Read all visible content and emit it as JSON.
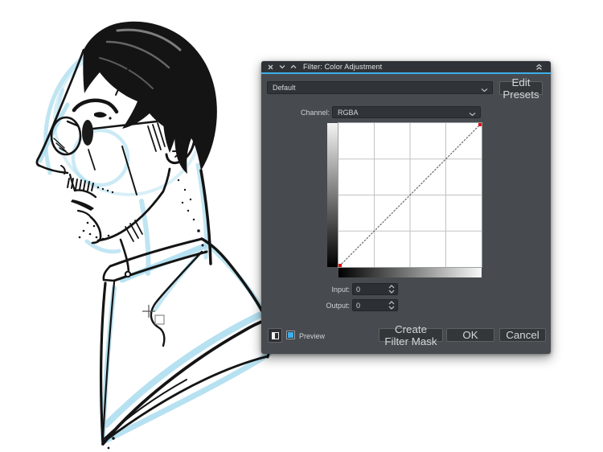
{
  "titlebar": {
    "title": "Filter: Color Adjustment",
    "icons": [
      "close-icon",
      "float-icon",
      "collapse-icon",
      "shade-icon"
    ]
  },
  "preset": {
    "selected": "Default",
    "edit_presets_label": "Edit Presets"
  },
  "channel": {
    "label": "Channel:",
    "selected": "RGBA"
  },
  "curve": {
    "grid_divisions": 4,
    "points": [
      [
        0,
        0
      ],
      [
        255,
        255
      ]
    ],
    "input_label": "Input:",
    "input_value": "0",
    "output_label": "Output:",
    "output_value": "0"
  },
  "footer": {
    "preview_label": "Preview",
    "create_filter_mask_label": "Create Filter Mask",
    "ok_label": "OK",
    "cancel_label": "Cancel"
  },
  "colors": {
    "accent": "#3daee9",
    "dialog_bg": "#474b4f",
    "titlebar_bg": "#2f3337",
    "field_bg": "#2c3034",
    "text": "#d5d8da",
    "curve_endpoint": "#dd1111",
    "sketch_blue": "#a9dcee",
    "ink": "#141414"
  }
}
